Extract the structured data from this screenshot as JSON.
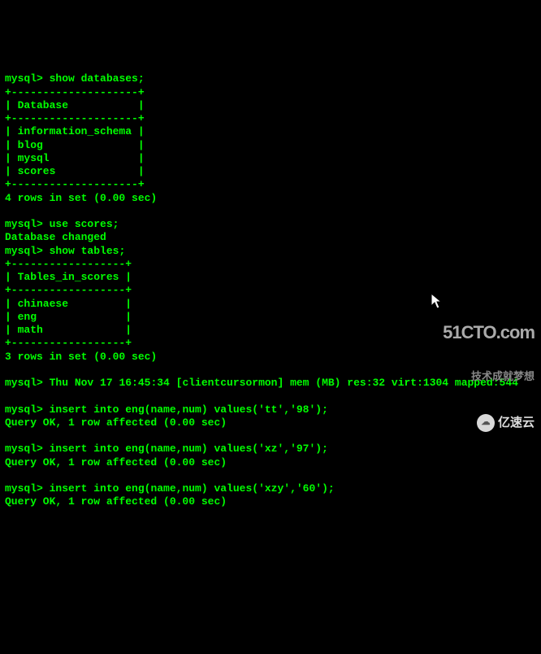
{
  "prompt": "mysql>",
  "cmd1": "show databases;",
  "tbl1_border": "+--------------------+",
  "tbl1_header": "| Database           |",
  "tbl1_rows": [
    "| information_schema |",
    "| blog               |",
    "| mysql              |",
    "| scores             |"
  ],
  "result1": "4 rows in set (0.00 sec)",
  "cmd2": "use scores;",
  "msg2": "Database changed",
  "cmd3": "show tables;",
  "tbl2_border": "+------------------+",
  "tbl2_header": "| Tables_in_scores |",
  "tbl2_rows": [
    "| chinaese         |",
    "| eng              |",
    "| math             |"
  ],
  "result2": "3 rows in set (0.00 sec)",
  "cmd4": "Thu Nov 17 16:45:34 [clientcursormon] mem (MB) res:32 virt:1304 mapped:544",
  "insert1": "insert into eng(name,num) values('tt','98');",
  "insert_ok": "Query OK, 1 row affected (0.00 sec)",
  "insert2": "insert into eng(name,num) values('xz','97');",
  "insert3": "insert into eng(name,num) values('xzy','60');",
  "watermark_51cto_main": "51CTO.com",
  "watermark_51cto_sub": "技术成就梦想",
  "watermark_yisu": "亿速云"
}
